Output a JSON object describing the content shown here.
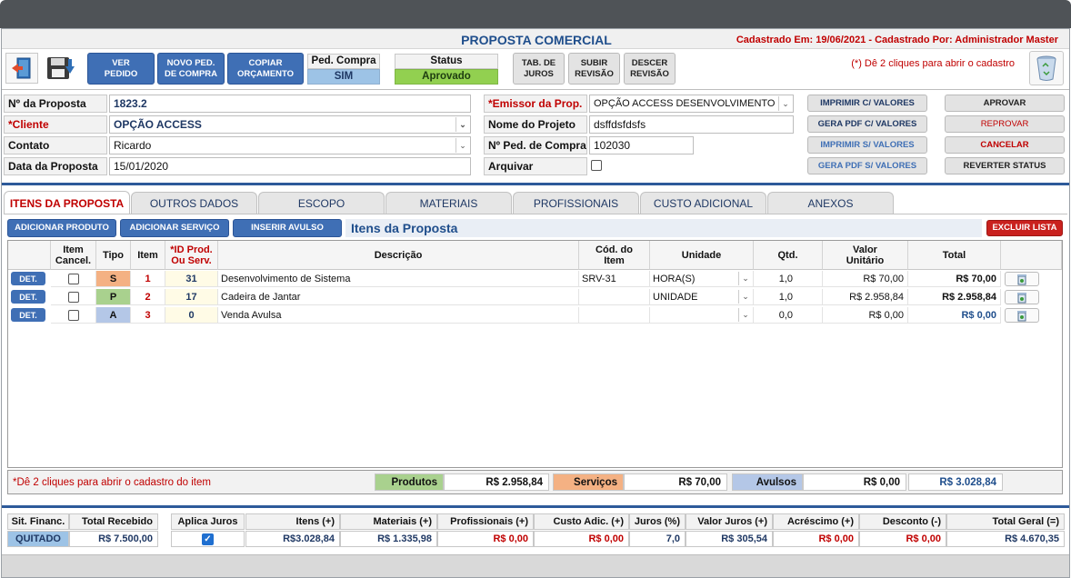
{
  "header": {
    "title": "PROPOSTA COMERCIAL",
    "registered": "Cadastrado Em: 19/06/2021 - Cadastrado Por: Administrador Master",
    "hint": "(*) Dê 2 cliques para abrir o cadastro"
  },
  "toolbar": {
    "ver_pedido": [
      "VER",
      "PEDIDO"
    ],
    "novo_pedido": [
      "NOVO PED.",
      "DE COMPRA"
    ],
    "copiar": [
      "COPIAR",
      "ORÇAMENTO"
    ],
    "ped_compra_label": "Ped. Compra",
    "ped_compra_value": "SIM",
    "status_label": "Status",
    "status_value": "Aprovado",
    "tab_juros": [
      "TAB. DE",
      "JUROS"
    ],
    "subir": [
      "SUBIR",
      "REVISÃO"
    ],
    "descer": [
      "DESCER",
      "REVISÃO"
    ]
  },
  "form": {
    "numero_label": "Nº da Proposta",
    "numero_value": "1823.2",
    "cliente_label": "*Cliente",
    "cliente_value": "OPÇÃO ACCESS",
    "contato_label": "Contato",
    "contato_value": "Ricardo",
    "data_label": "Data da Proposta",
    "data_value": "15/01/2020",
    "emissor_label": "*Emissor da Prop.",
    "emissor_value": "OPÇÃO ACCESS DESENVOLVIMENTO DE",
    "projeto_label": "Nome do Projeto",
    "projeto_value": "dsffdsfdsfs",
    "pedcompra_label": "Nº Ped. de Compra",
    "pedcompra_value": "102030",
    "arquivar_label": "Arquivar"
  },
  "actions": {
    "imprimir_valores": "IMPRIMIR C/ VALORES",
    "pdf_valores": "GERA PDF C/ VALORES",
    "imprimir_sem": "IMPRIMIR S/ VALORES",
    "pdf_sem": "GERA PDF S/ VALORES",
    "aprovar": "APROVAR",
    "reprovar": "REPROVAR",
    "cancelar": "CANCELAR",
    "reverter": "REVERTER STATUS"
  },
  "tabs": [
    "ITENS DA PROPOSTA",
    "OUTROS DADOS",
    "ESCOPO",
    "MATERIAIS",
    "PROFISSIONAIS",
    "CUSTO ADICIONAL",
    "ANEXOS"
  ],
  "items_toolbar": {
    "add_produto": "ADICIONAR PRODUTO",
    "add_servico": "ADICIONAR SERVIÇO",
    "inserir_avulso": "INSERIR AVULSO",
    "section_title": "Itens da Proposta",
    "excluir": "EXCLUIR LISTA"
  },
  "grid": {
    "headers": {
      "cancel": [
        "Item",
        "Cancel."
      ],
      "tipo": "Tipo",
      "item": "Item",
      "id": [
        "*ID Prod.",
        "Ou Serv."
      ],
      "descricao": "Descrição",
      "cod": [
        "Cód. do",
        "Item"
      ],
      "unidade": "Unidade",
      "qtd": "Qtd.",
      "valor": [
        "Valor",
        "Unitário"
      ],
      "total": "Total"
    },
    "det_label": "DET.",
    "rows": [
      {
        "tipo": "S",
        "item": "1",
        "id": "31",
        "descricao": "Desenvolvimento de Sistema",
        "cod": "SRV-31",
        "unidade": "HORA(S)",
        "qtd": "1,0",
        "valor": "R$ 70,00",
        "total": "R$ 70,00"
      },
      {
        "tipo": "P",
        "item": "2",
        "id": "17",
        "descricao": "Cadeira de Jantar",
        "cod": "",
        "unidade": "UNIDADE",
        "qtd": "1,0",
        "valor": "R$ 2.958,84",
        "total": "R$ 2.958,84"
      },
      {
        "tipo": "A",
        "item": "3",
        "id": "0",
        "descricao": "Venda Avulsa",
        "cod": "",
        "unidade": "",
        "qtd": "0,0",
        "valor": "R$ 0,00",
        "total": "R$ 0,00"
      }
    ]
  },
  "summary": {
    "hint": "*Dê 2 cliques para abrir o cadastro do item",
    "produtos_label": "Produtos",
    "produtos_value": "R$ 2.958,84",
    "servicos_label": "Serviços",
    "servicos_value": "R$ 70,00",
    "avulsos_label": "Avulsos",
    "avulsos_value": "R$ 0,00",
    "total_value": "R$ 3.028,84"
  },
  "bottom": {
    "sit_label": "Sit. Financ.",
    "sit_value": "QUITADO",
    "recebido_label": "Total Recebido",
    "recebido_value": "R$ 7.500,00",
    "juros_label": "Aplica Juros",
    "itens_label": "Itens (+)",
    "itens_value": "R$3.028,84",
    "materiais_label": "Materiais (+)",
    "materiais_value": "R$ 1.335,98",
    "prof_label": "Profissionais (+)",
    "prof_value": "R$ 0,00",
    "custo_label": "Custo Adic. (+)",
    "custo_value": "R$ 0,00",
    "jurosp_label": "Juros (%)",
    "jurosp_value": "7,0",
    "valorjuros_label": "Valor Juros (+)",
    "valorjuros_value": "R$ 305,54",
    "acrescimo_label": "Acréscimo (+)",
    "acrescimo_value": "R$ 0,00",
    "desconto_label": "Desconto (-)",
    "desconto_value": "R$ 0,00",
    "totalgeral_label": "Total Geral (=)",
    "totalgeral_value": "R$ 4.670,35"
  },
  "colors": {
    "tipo_S": "#f4b183",
    "tipo_P": "#a9d18e",
    "tipo_A": "#b4c7e7",
    "accent": "#3f6fb5",
    "alert": "#c00000"
  }
}
